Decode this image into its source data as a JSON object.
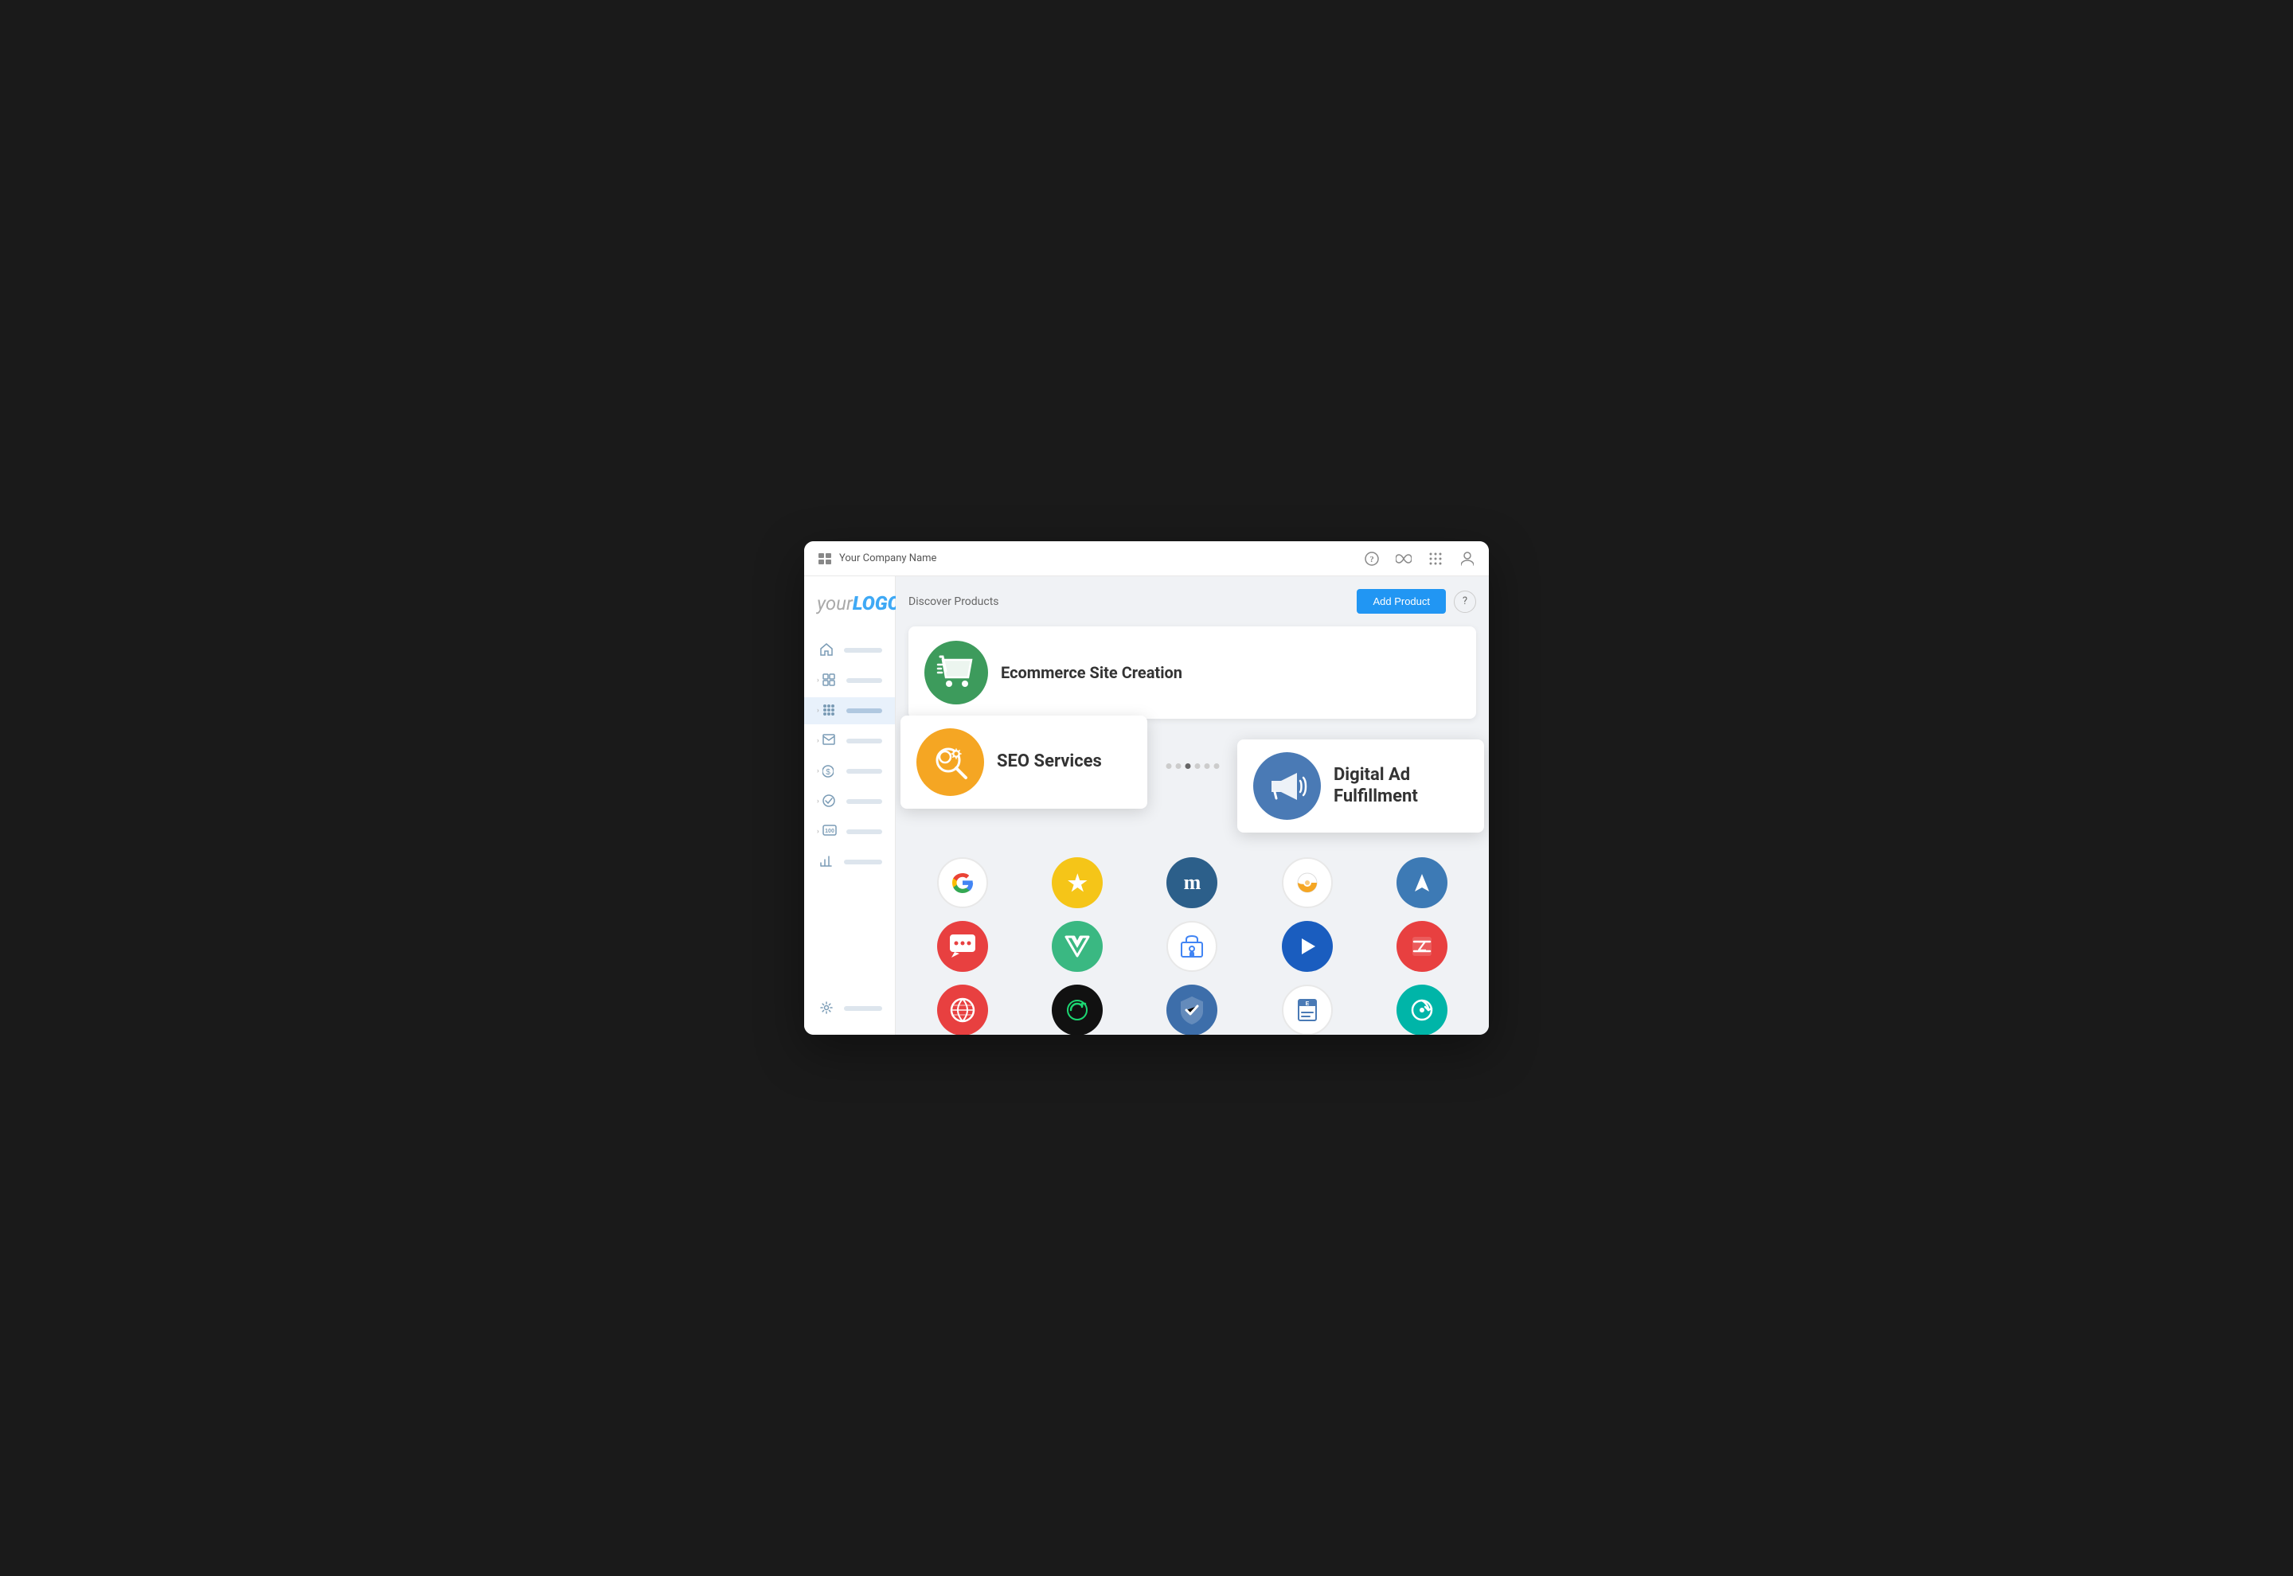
{
  "topbar": {
    "company_name": "Your Company Name",
    "icons": [
      "?",
      "∞",
      "⋯",
      "👤"
    ]
  },
  "sidebar": {
    "logo": {
      "your": "your",
      "logo": "LOGO"
    },
    "items": [
      {
        "id": "home",
        "icon": "home",
        "active": false
      },
      {
        "id": "grid-small",
        "icon": "grid",
        "active": false
      },
      {
        "id": "apps",
        "icon": "apps",
        "active": true
      },
      {
        "id": "mail",
        "icon": "mail",
        "active": false
      },
      {
        "id": "dollar",
        "icon": "dollar",
        "active": false
      },
      {
        "id": "check",
        "icon": "check",
        "active": false
      },
      {
        "id": "hundred",
        "icon": "hundred",
        "active": false
      },
      {
        "id": "chart",
        "icon": "chart",
        "active": false
      },
      {
        "id": "settings",
        "icon": "settings",
        "active": false
      }
    ]
  },
  "header": {
    "discover_title": "Discover Products",
    "add_product_label": "Add Product",
    "help_label": "?"
  },
  "featured": [
    {
      "id": "ecommerce",
      "title": "Ecommerce Site Creation",
      "icon_color": "#3d9b5c",
      "icon_type": "cart"
    }
  ],
  "floating_cards": [
    {
      "id": "seo",
      "title": "SEO Services",
      "icon_color": "#f5a623",
      "icon_type": "seo"
    },
    {
      "id": "digital-ad",
      "title": "Digital Ad Fulfillment",
      "icon_color": "#4a7ab5",
      "icon_type": "megaphone"
    }
  ],
  "dots": [
    1,
    2,
    3,
    4,
    5,
    6
  ],
  "active_dot": 3,
  "products": [
    {
      "id": "google",
      "label": "G",
      "bg": "#fff",
      "border": true,
      "text_color": "#4285f4"
    },
    {
      "id": "trustpilot",
      "label": "★",
      "bg": "#f5c518",
      "text_color": "#fff"
    },
    {
      "id": "moz",
      "label": "m",
      "bg": "#2c5f8a",
      "text_color": "#fff"
    },
    {
      "id": "conductor",
      "label": "◑",
      "bg": "#fff",
      "border": true,
      "text_color": "#f5a623"
    },
    {
      "id": "arrowsail",
      "label": "▲",
      "bg": "#3d7ab5",
      "text_color": "#fff"
    },
    {
      "id": "chatlio",
      "label": "💬",
      "bg": "#e84040",
      "text_color": "#fff"
    },
    {
      "id": "vue",
      "label": "▽",
      "bg": "#3ab882",
      "text_color": "#fff"
    },
    {
      "id": "gmb",
      "label": "🏪",
      "bg": "#fff",
      "border": true,
      "text_color": "#4285f4"
    },
    {
      "id": "promoteiq",
      "label": "▶",
      "bg": "#1a5dbf",
      "text_color": "#fff"
    },
    {
      "id": "zift",
      "label": "Z",
      "bg": "#e84040",
      "text_color": "#fff"
    },
    {
      "id": "web-globe",
      "label": "🌐",
      "bg": "#e84040",
      "text_color": "#fff"
    },
    {
      "id": "godaddy",
      "label": "⊙",
      "bg": "#111",
      "text_color": "#1cd672"
    },
    {
      "id": "trustseal",
      "label": "✓",
      "bg": "#3d6eaa",
      "text_color": "#fff"
    },
    {
      "id": "eset",
      "label": "E≡",
      "bg": "#fff",
      "border": true,
      "text_color": "#666"
    },
    {
      "id": "zinglife",
      "label": "↺",
      "bg": "#00b5a8",
      "text_color": "#fff"
    }
  ]
}
